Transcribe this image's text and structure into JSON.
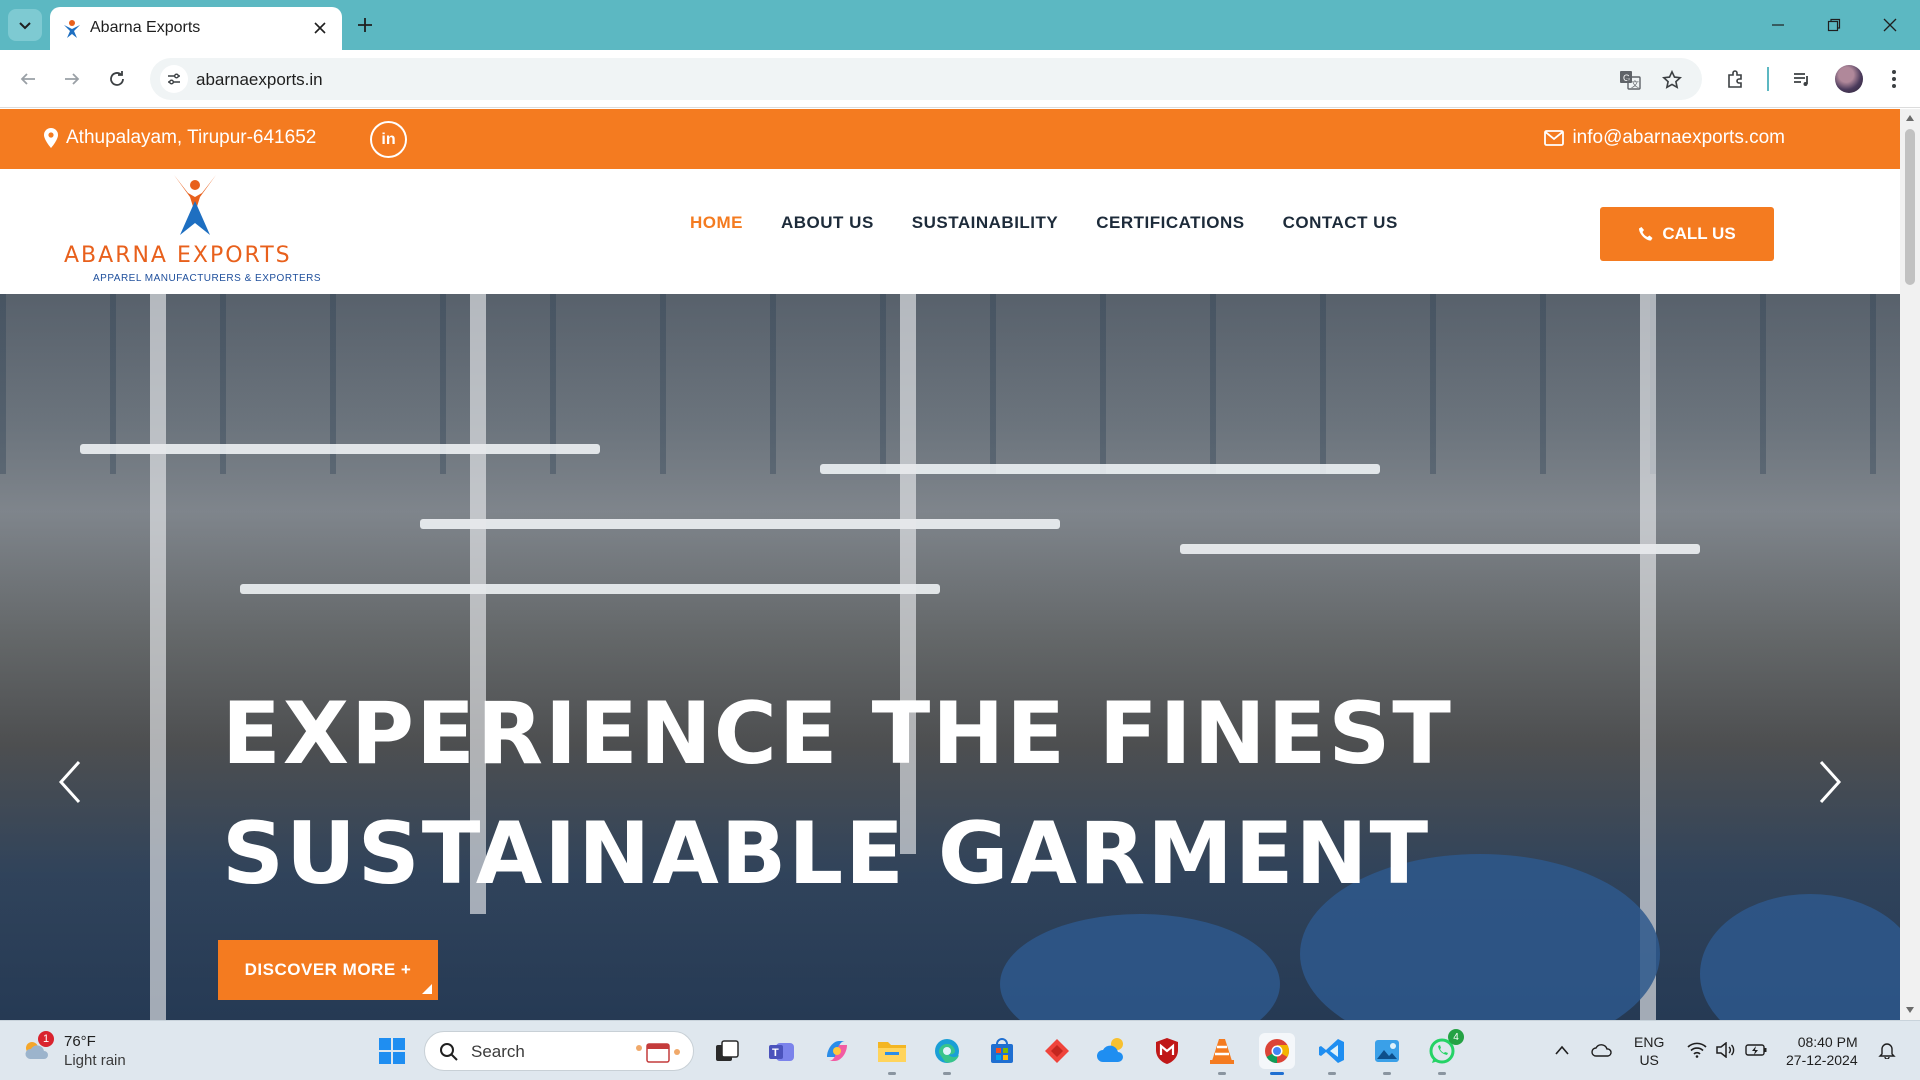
{
  "browser": {
    "tab_title": "Abarna Exports",
    "url": "abarnaexports.in"
  },
  "site": {
    "location": "Athupalayam, Tirupur-641652",
    "linkedin_label": "in",
    "email": "info@abarnaexports.com",
    "brand_name": "ABARNA EXPORTS",
    "brand_tagline": "APPAREL MANUFACTURERS & EXPORTERS",
    "nav": [
      {
        "label": "HOME",
        "active": true
      },
      {
        "label": "ABOUT US",
        "active": false
      },
      {
        "label": "SUSTAINABILITY",
        "active": false
      },
      {
        "label": "CERTIFICATIONS",
        "active": false
      },
      {
        "label": "CONTACT US",
        "active": false
      }
    ],
    "call_button": "CALL US",
    "hero": {
      "line1": "EXPERIENCE THE FINEST",
      "line2": "SUSTAINABLE GARMENT",
      "cta": "DISCOVER MORE +"
    },
    "colors": {
      "accent": "#f47b20",
      "nav_text": "#1d2b3a",
      "brand_blue": "#1e4f9c"
    }
  },
  "taskbar": {
    "weather_temp": "76°F",
    "weather_condition": "Light rain",
    "weather_badge": "1",
    "search_placeholder": "Search",
    "whatsapp_badge": "4",
    "lang_line1": "ENG",
    "lang_line2": "US",
    "time": "08:40 PM",
    "date": "27-12-2024"
  }
}
